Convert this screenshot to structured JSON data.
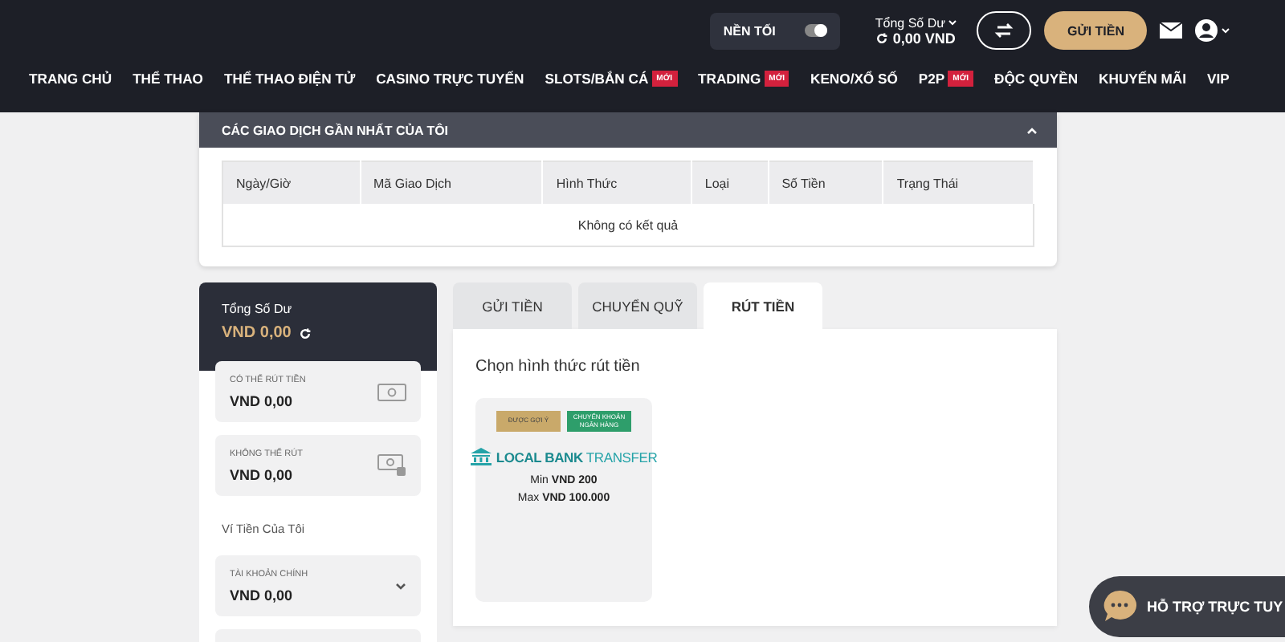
{
  "header": {
    "theme_toggle": {
      "label": "NỀN TỐI",
      "on": true
    },
    "balance": {
      "label": "Tổng Số Dư",
      "value": "0,00 VND"
    },
    "deposit_button": "GỬI TIỀN"
  },
  "nav": [
    {
      "label": "TRANG CHỦ"
    },
    {
      "label": "THỂ THAO"
    },
    {
      "label": "THỂ THAO ĐIỆN TỬ"
    },
    {
      "label": "CASINO TRỰC TUYẾN"
    },
    {
      "label": "SLOTS/BẮN CÁ",
      "badge": "MỚI"
    },
    {
      "label": "TRADING",
      "badge": "MỚI"
    },
    {
      "label": "KENO/XỔ SỐ"
    },
    {
      "label": "P2P",
      "badge": "MỚI"
    },
    {
      "label": "ĐỘC QUYỀN"
    },
    {
      "label": "KHUYẾN MÃI"
    },
    {
      "label": "VIP"
    }
  ],
  "transactions": {
    "title": "CÁC GIAO DỊCH GẦN NHẤT CỦA TÔI",
    "columns": [
      "Ngày/Giờ",
      "Mã Giao Dịch",
      "Hình Thức",
      "Loại",
      "Số Tiền",
      "Trạng Thái"
    ],
    "empty_text": "Không có kết quả"
  },
  "wallet": {
    "total_label": "Tổng Số Dư",
    "total_value": "VND  0,00",
    "balances": [
      {
        "label": "CÓ THỂ RÚT TIỀN",
        "value": "VND  0,00",
        "kind": "cash"
      },
      {
        "label": "KHÔNG THỂ RÚT",
        "value": "VND  0,00",
        "kind": "locked"
      }
    ],
    "my_wallets_label": "Ví Tiền Của Tôi",
    "wallets": [
      {
        "label": "TÀI KHOẢN CHÍNH",
        "value": "VND  0,00"
      }
    ]
  },
  "payment_tabs": [
    {
      "label": "GỬI TIỀN",
      "selected": false
    },
    {
      "label": "CHUYỂN QUỸ",
      "selected": false
    },
    {
      "label": "RÚT TIỀN",
      "selected": true
    }
  ],
  "withdraw": {
    "heading": "Chọn hình thức rút tiền",
    "methods": [
      {
        "tags": [
          {
            "text": "ĐƯỢC GỢI Ý",
            "color": "#c9a96a"
          },
          {
            "text": "CHUYỂN KHOẢN NGÂN HÀNG",
            "color": "#2e9e6b"
          }
        ],
        "name": "**LOCAL BANK** TRANSFER",
        "min": "Min **VND 200**",
        "max": "Max **VND 100.000**"
      }
    ]
  },
  "chat_button": "HỖ TRỢ TRỰC TUY"
}
